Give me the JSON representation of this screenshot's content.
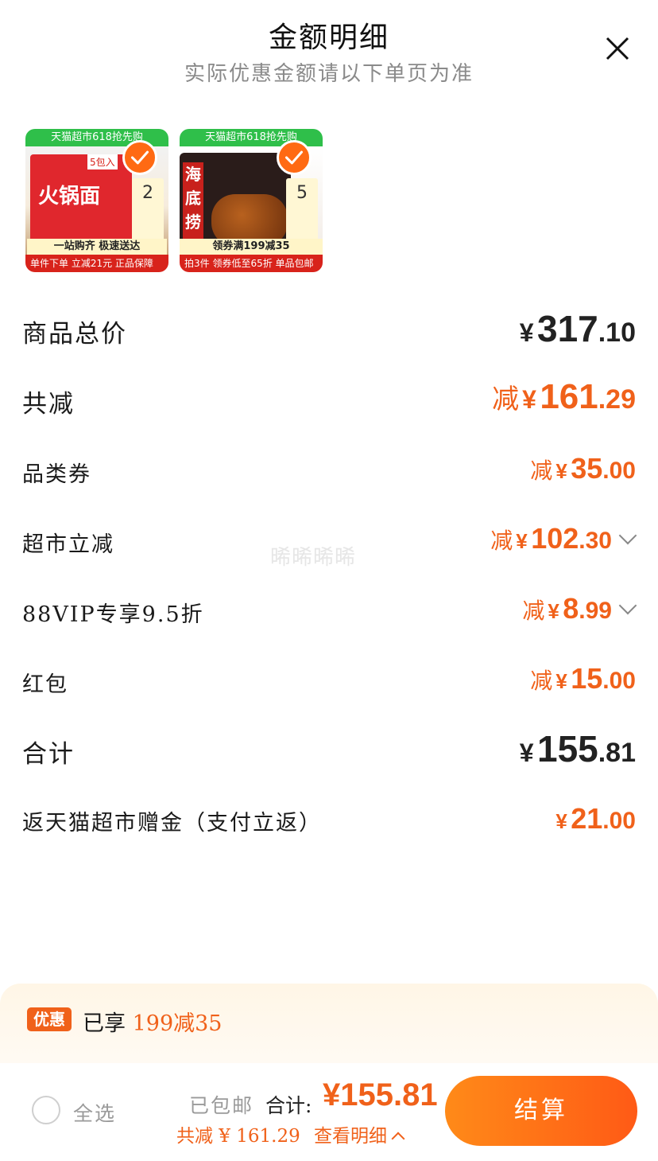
{
  "header": {
    "title": "金额明细",
    "subtitle": "实际优惠金额请以下单页为准"
  },
  "products": [
    {
      "banner": "天猫超市618抢先购",
      "name": "火锅面",
      "tag": "5包入",
      "middle": "一站购齐 极速送达",
      "bottom": "单件下单 立减21元 正品保障",
      "side": "2",
      "selected": true
    },
    {
      "banner": "天猫超市618抢先购",
      "brand": "海底捞",
      "middle": "领券满199减35",
      "bottom": "拍3件 领券低至65折 单品包邮",
      "side": "5",
      "selected": true
    }
  ],
  "rows": [
    {
      "label": "商品总价",
      "prefix": "",
      "yen": "¥",
      "int": "317",
      "dec": ".10",
      "expandable": false
    },
    {
      "label": "共减",
      "prefix": "减",
      "yen": "¥",
      "int": "161",
      "dec": ".29",
      "expandable": false
    },
    {
      "label": "品类券",
      "prefix": "减",
      "yen": "¥",
      "int": "35",
      "dec": ".00",
      "expandable": false
    },
    {
      "label": "超市立减",
      "prefix": "减",
      "yen": "¥",
      "int": "102",
      "dec": ".30",
      "expandable": true
    },
    {
      "label": "88VIP专享9.5折",
      "prefix": "减",
      "yen": "¥",
      "int": "8",
      "dec": ".99",
      "expandable": true
    },
    {
      "label": "红包",
      "prefix": "减",
      "yen": "¥",
      "int": "15",
      "dec": ".00",
      "expandable": false
    },
    {
      "label": "合计",
      "prefix": "",
      "yen": "¥",
      "int": "155",
      "dec": ".81",
      "expandable": false
    },
    {
      "label": "返天猫超市赠金（支付立返）",
      "prefix": "",
      "yen": "¥",
      "int": "21",
      "dec": ".00",
      "expandable": false
    }
  ],
  "watermark": "晞晞晞晞",
  "promo": {
    "badge": "优惠",
    "text_prefix": "已享",
    "text_highlight": "199减35"
  },
  "footer": {
    "select_all": "全选",
    "free_shipping": "已包邮",
    "total_label": "合计:",
    "total_value": "¥155.81",
    "reduce_text": "共减 ¥ 161.29",
    "detail_link": "查看明细",
    "pay_button": "结算"
  },
  "colors": {
    "accent": "#f0611a",
    "button_start": "#ff8a18",
    "button_end": "#ff5a16"
  }
}
